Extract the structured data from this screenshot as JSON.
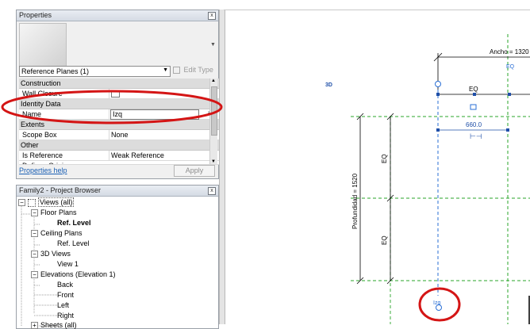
{
  "properties": {
    "title": "Properties",
    "close_glyph": "x",
    "type_selector": "Reference Planes (1)",
    "edit_type": "Edit Type",
    "categories": [
      {
        "label": "Construction",
        "rows": [
          {
            "key": "Wall Closure",
            "value": ""
          }
        ]
      },
      {
        "label": "Identity Data",
        "rows": [
          {
            "key": "Name",
            "value": "Izq"
          }
        ]
      },
      {
        "label": "Extents",
        "rows": [
          {
            "key": "Scope Box",
            "value": "None"
          }
        ]
      },
      {
        "label": "Other",
        "rows": [
          {
            "key": "Is Reference",
            "value": "Weak Reference"
          },
          {
            "key": "Defines Origin",
            "value": ""
          }
        ]
      }
    ],
    "help_link": "Properties help",
    "apply": "Apply"
  },
  "browser": {
    "title": "Family2 - Project Browser",
    "close_glyph": "x",
    "items": [
      {
        "label": "Views (all)"
      },
      {
        "label": "Floor Plans"
      },
      {
        "label": "Ref. Level"
      },
      {
        "label": "Ceiling Plans"
      },
      {
        "label": "Ref. Level"
      },
      {
        "label": "3D Views"
      },
      {
        "label": "View 1"
      },
      {
        "label": "Elevations (Elevation 1)"
      },
      {
        "label": "Back"
      },
      {
        "label": "Front"
      },
      {
        "label": "Left"
      },
      {
        "label": "Right"
      },
      {
        "label": "Sheets (all)"
      }
    ]
  },
  "canvas": {
    "label_3d": "3D",
    "ancho": "Ancho = 1320",
    "eq_top": "EQ",
    "eq_top2": "EQ",
    "dim_660": "660.0",
    "profundidad": "Profundidad = 1520",
    "eq_side1": "EQ",
    "eq_side2": "EQ",
    "izq": "Izq"
  },
  "colors": {
    "accent_red": "#d41515",
    "plane_blue": "#2a6fd6",
    "plane_green": "#2aa52a"
  }
}
